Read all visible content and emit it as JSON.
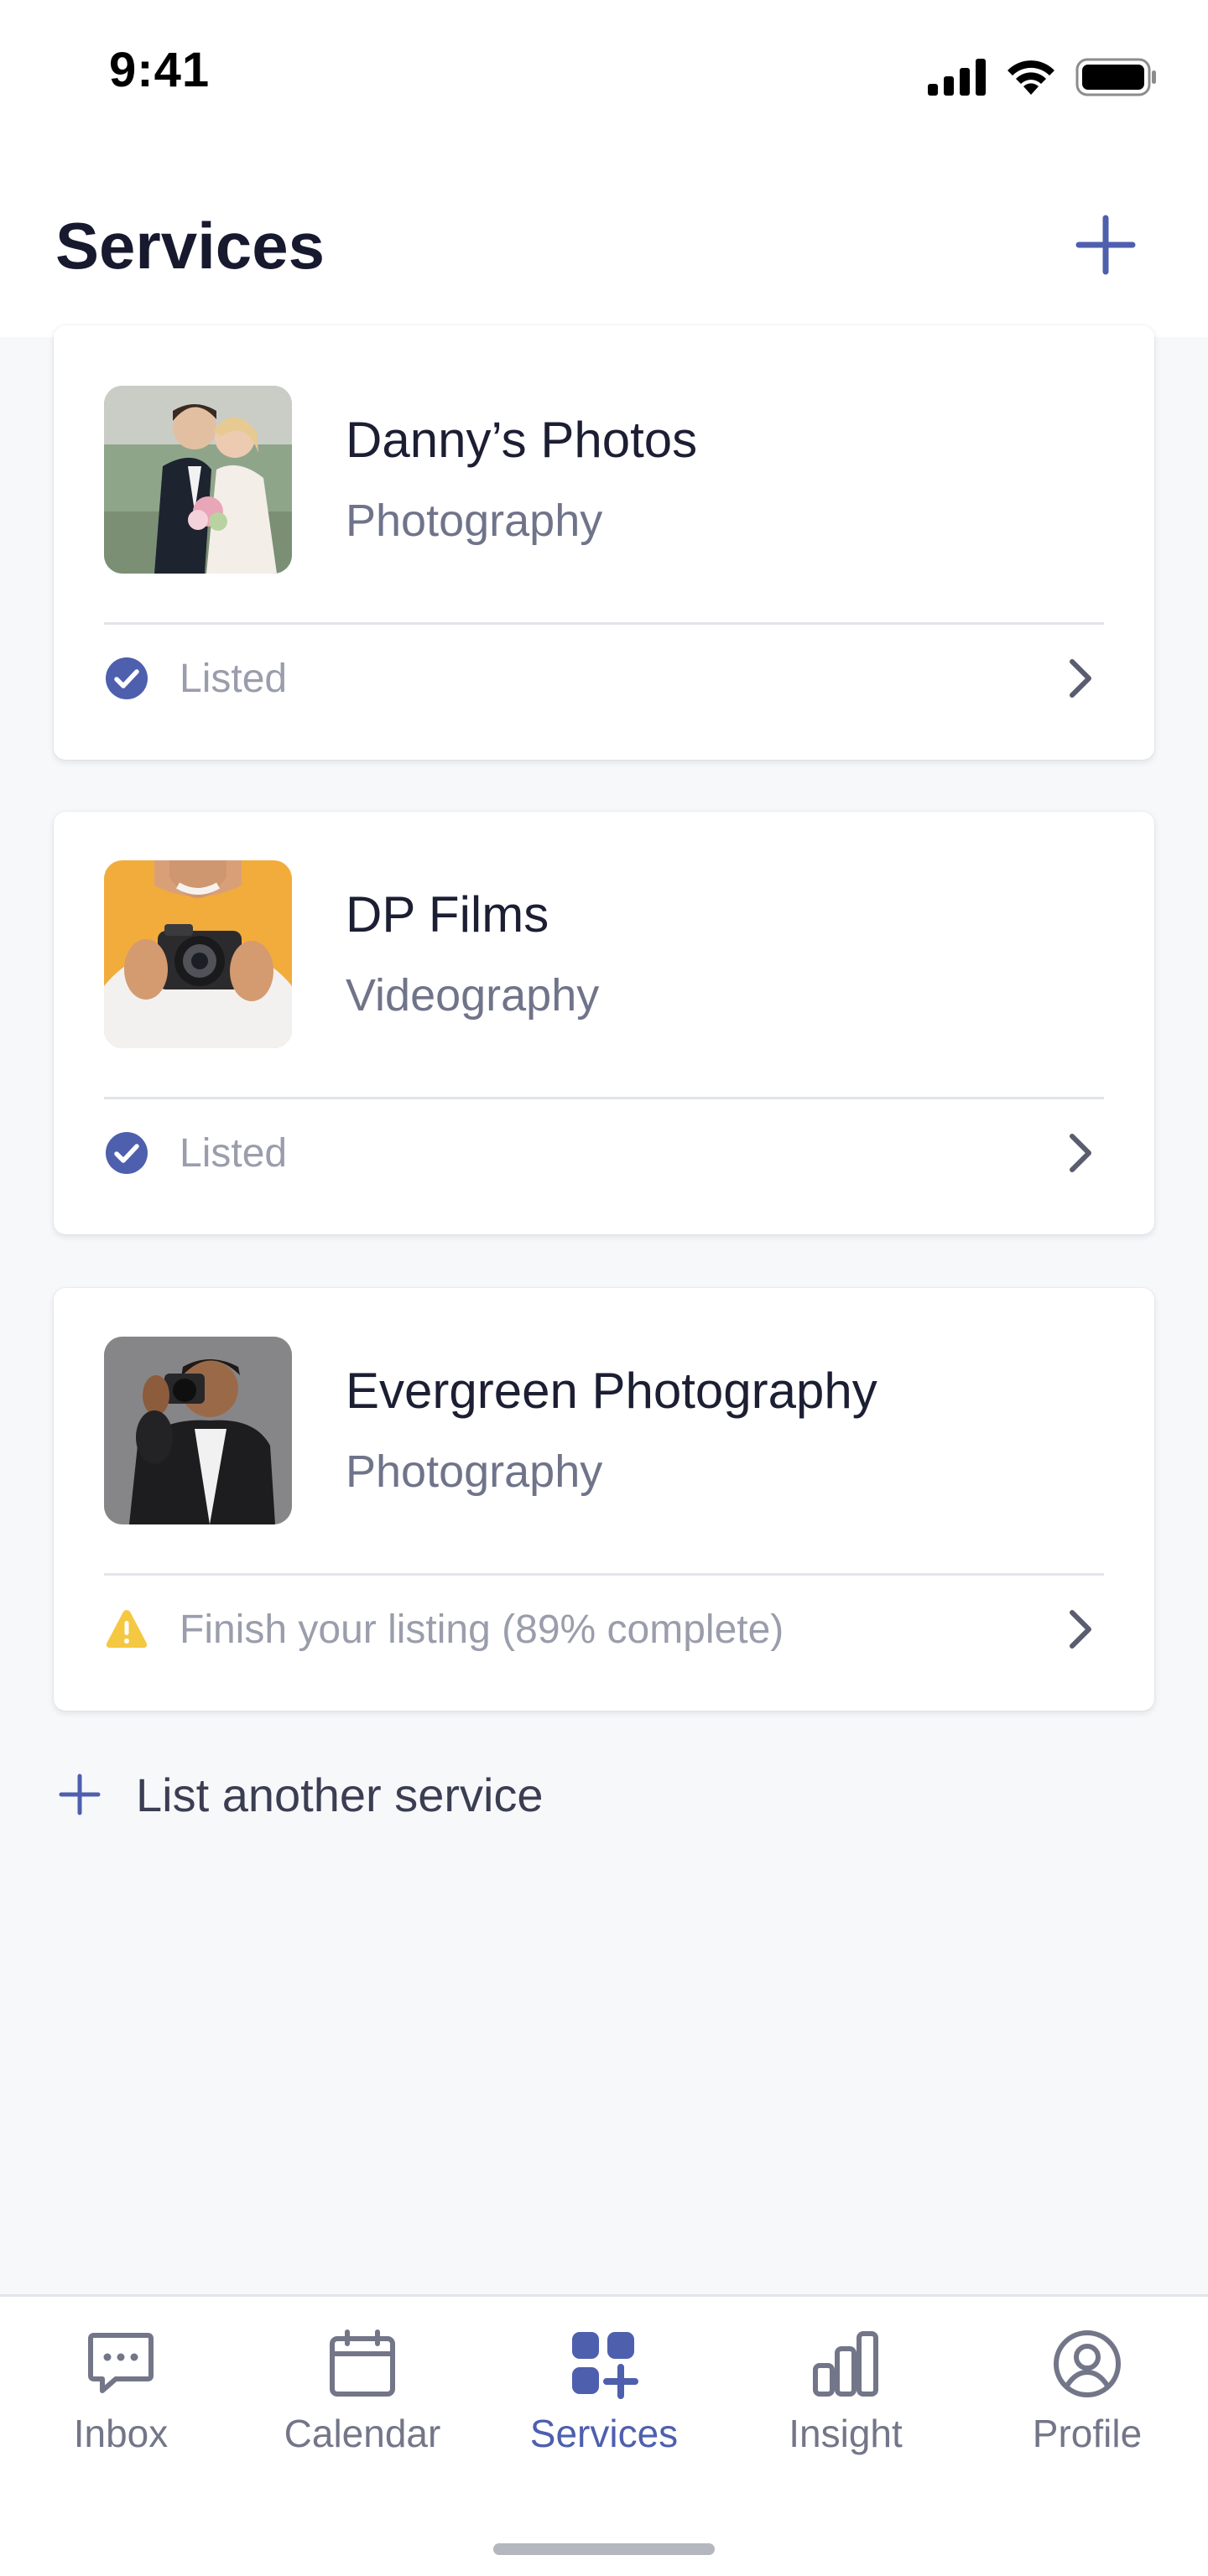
{
  "status_bar": {
    "time": "9:41"
  },
  "header": {
    "title": "Services"
  },
  "services": [
    {
      "name": "Danny’s Photos",
      "category": "Photography",
      "status": "Listed",
      "status_type": "listed",
      "thumb_icon": "wedding-couple-photo"
    },
    {
      "name": "DP Films",
      "category": "Videography",
      "status": "Listed",
      "status_type": "listed",
      "thumb_icon": "man-with-camera-photo"
    },
    {
      "name": "Evergreen Photography",
      "category": "Photography",
      "status": "Finish your listing (89% complete)",
      "status_type": "warning",
      "completion_percent": 89,
      "thumb_icon": "photographer-portrait-photo"
    }
  ],
  "list_another": {
    "label": "List another service"
  },
  "tab_bar": {
    "active": "Services",
    "tabs": [
      {
        "label": "Inbox",
        "icon": "chat-bubble-icon"
      },
      {
        "label": "Calendar",
        "icon": "calendar-icon"
      },
      {
        "label": "Services",
        "icon": "services-grid-icon"
      },
      {
        "label": "Insight",
        "icon": "bar-chart-icon"
      },
      {
        "label": "Profile",
        "icon": "user-circle-icon"
      }
    ]
  },
  "colors": {
    "accent": "#4e5fae",
    "listed": "#4e5fae",
    "warning": "#f5c842",
    "muted_text": "#9a9dab"
  }
}
